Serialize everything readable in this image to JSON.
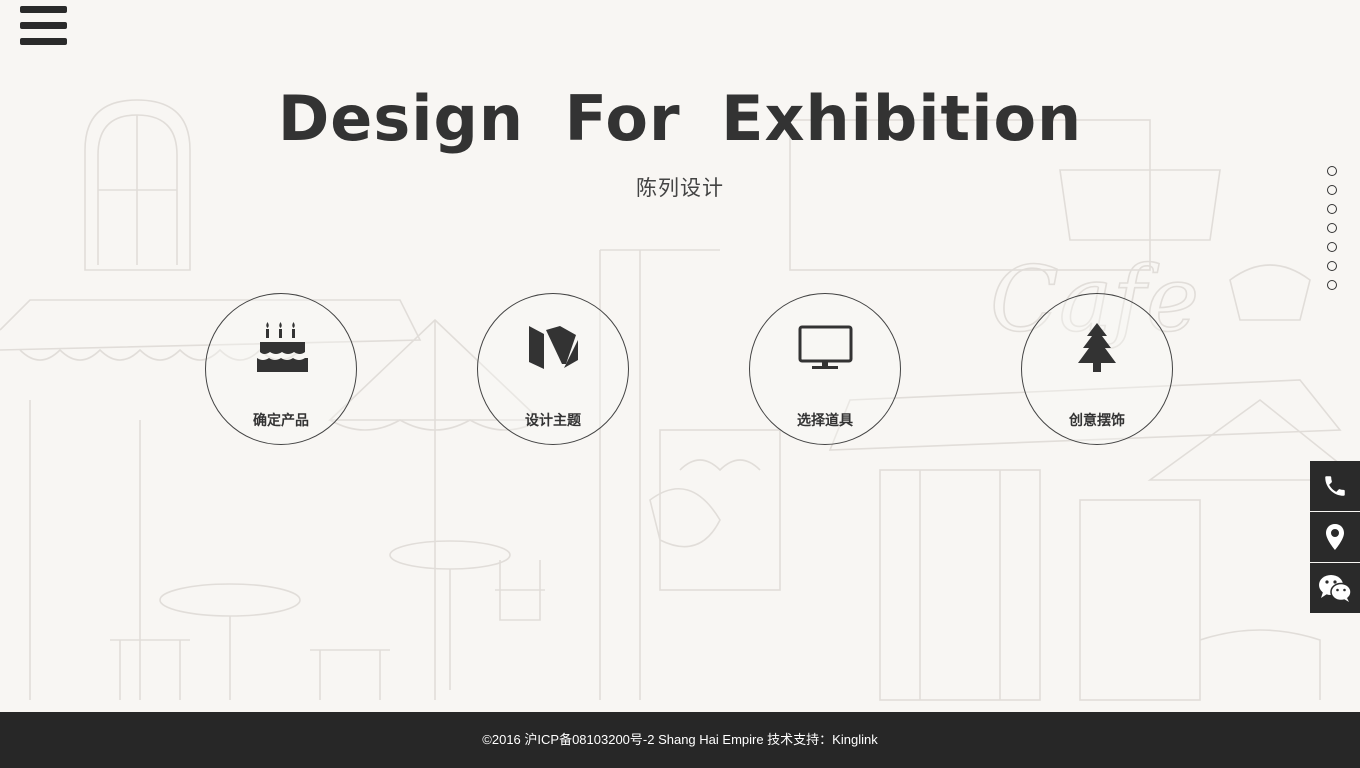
{
  "header": {
    "menu_icon": "hamburger-menu-icon"
  },
  "hero": {
    "title": "Design  For  Exhibition",
    "subtitle": "陈列设计"
  },
  "section_nav": {
    "count": 7
  },
  "features": [
    {
      "icon": "cake-icon",
      "label": "确定产品"
    },
    {
      "icon": "medium-logo-icon",
      "label": "设计主题"
    },
    {
      "icon": "monitor-icon",
      "label": "选择道具"
    },
    {
      "icon": "tree-icon",
      "label": "创意摆饰"
    }
  ],
  "side_contact": [
    {
      "icon": "phone-icon"
    },
    {
      "icon": "location-pin-icon"
    },
    {
      "icon": "wechat-icon"
    }
  ],
  "footer": {
    "text": "©2016  沪ICP备08103200号-2 Shang  Hai  Empire  技术支持：Kinglink"
  },
  "colors": {
    "background": "#f8f6f3",
    "text": "#333333",
    "footer_bg": "#272727",
    "side_button_bg": "#2a2a2a"
  }
}
